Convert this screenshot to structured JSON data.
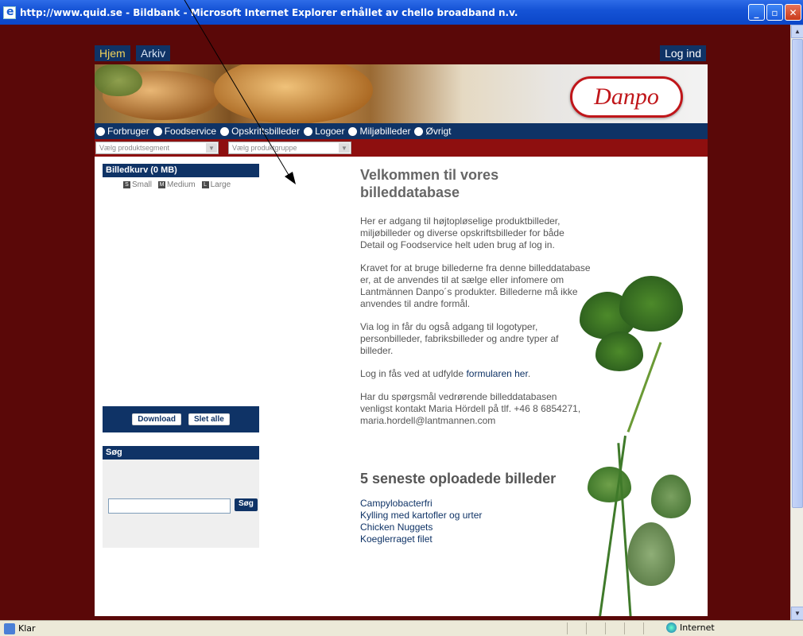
{
  "window": {
    "title": "http://www.quid.se - Bildbank - Microsoft Internet Explorer erhållet av chello broadband n.v.",
    "minimize": "_",
    "maximize": "▫",
    "close": "✕"
  },
  "topnav": {
    "home": "Hjem",
    "archive": "Arkiv",
    "login": "Log ind"
  },
  "logo": {
    "text": "Danpo"
  },
  "categories": [
    "Forbruger",
    "Foodservice",
    "Opskriftsbilleder",
    "Logoer",
    "Miljøbilleder",
    "Øvrigt"
  ],
  "filters": {
    "segment": "Vælg produktsegment",
    "group": "Vælg produktgruppe"
  },
  "basket": {
    "title": "Billedkurv (0 MB)",
    "sizes": [
      {
        "badge": "S",
        "label": "Small"
      },
      {
        "badge": "M",
        "label": "Medium"
      },
      {
        "badge": "L",
        "label": "Large"
      }
    ],
    "download": "Download",
    "delete_all": "Slet alle"
  },
  "search": {
    "title": "Søg",
    "button": "Søg",
    "value": ""
  },
  "main": {
    "heading": "Velkommen til vores billeddatabase",
    "p1": "Her er adgang til højtopløselige produktbilleder, miljøbilleder og diverse opskriftsbilleder for både Detail og Foodservice helt uden brug af log in.",
    "p2": "Kravet for at bruge billederne fra denne billeddatabase er, at de anvendes til at sælge eller infomere om Lantmännen Danpo´s produkter. Billederne må ikke anvendes til andre formål.",
    "p3": "Via log in får du også adgang til logotyper, personbilleder, fabriksbilleder og andre typer af billeder.",
    "p4_prefix": "Log in fås ved at udfylde ",
    "p4_link": "formularen her",
    "p4_suffix": ".",
    "p5": "Har du spørgsmål vedrørende billeddatabasen venligst kontakt Maria Hördell på tlf. +46 8 6854271, maria.hordell@lantmannen.com",
    "uploads_heading": "5 seneste oploadede billeder",
    "uploads": [
      "Campylobacterfri",
      "Kylling med kartofler og urter",
      "Chicken Nuggets",
      "Koeglerraget filet"
    ]
  },
  "status": {
    "left": "Klar",
    "zone": "Internet"
  },
  "colors": {
    "navy": "#0f3366",
    "maroon": "#8e0f0f",
    "background": "#5a0808",
    "brand_red": "#c0161a"
  }
}
